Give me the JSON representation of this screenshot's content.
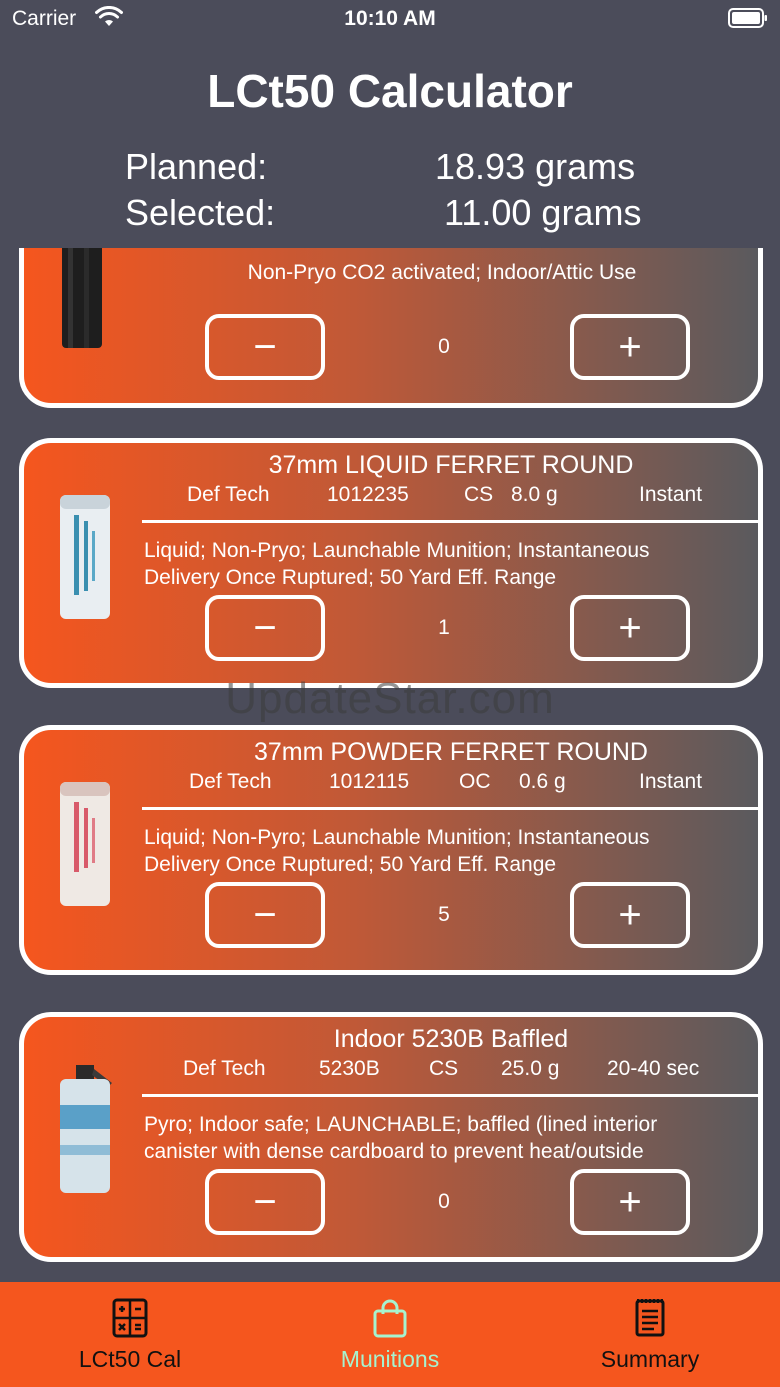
{
  "status_bar": {
    "carrier": "Carrier",
    "time": "10:10 AM"
  },
  "header": {
    "title": "LCt50 Calculator",
    "planned_label": "Planned:",
    "planned_value": "18.93 grams",
    "selected_label": "Selected:",
    "selected_value": "11.00 grams"
  },
  "munitions": [
    {
      "title": "",
      "specs": [],
      "description": [
        "Non-Pryo CO2 activated; Indoor/Attic Use"
      ],
      "minus": "−",
      "plus": "+",
      "quantity": "0"
    },
    {
      "title": "37mm LIQUID FERRET ROUND",
      "specs": [
        "Def Tech",
        "1012235",
        "CS",
        "8.0 g",
        "Instant"
      ],
      "description": [
        "Liquid; Non-Pryo; Launchable Munition; Instantaneous",
        "Delivery Once Ruptured; 50 Yard Eff. Range"
      ],
      "minus": "−",
      "plus": "+",
      "quantity": "1"
    },
    {
      "title": "37mm POWDER FERRET ROUND",
      "specs": [
        "Def Tech",
        "1012115",
        "OC",
        "0.6 g",
        "Instant"
      ],
      "description": [
        "Liquid; Non-Pyro; Launchable Munition; Instantaneous",
        "Delivery Once Ruptured; 50 Yard Eff. Range"
      ],
      "minus": "−",
      "plus": "+",
      "quantity": "5"
    },
    {
      "title": "Indoor 5230B Baffled",
      "specs": [
        "Def Tech",
        "5230B",
        "CS",
        "25.0 g",
        "20-40 sec"
      ],
      "description": [
        "Pyro; Indoor safe; LAUNCHABLE; baffled (lined interior",
        "canister with dense cardboard to prevent heat/outside"
      ],
      "minus": "−",
      "plus": "+",
      "quantity": "0"
    }
  ],
  "watermark": "UpdateStar.com",
  "tabs": [
    {
      "label": "LCt50 Cal",
      "icon": "calculator-icon"
    },
    {
      "label": "Munitions",
      "icon": "shopping-bag-icon",
      "active": true
    },
    {
      "label": "Summary",
      "icon": "document-list-icon"
    }
  ],
  "colors": {
    "background": "#4b4c5a",
    "accent": "#f5561e",
    "active_tab": "#a6f3cf"
  }
}
